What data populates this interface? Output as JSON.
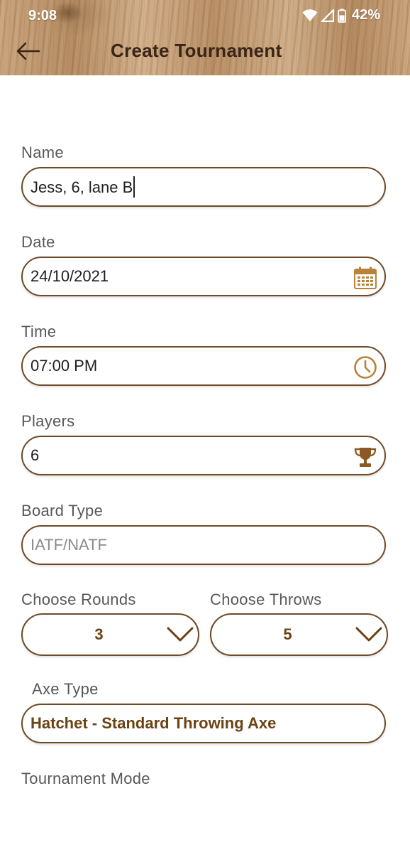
{
  "status_bar": {
    "time": "9:08",
    "battery_percent": "42%",
    "icons": [
      "wifi-icon",
      "signal-icon",
      "battery-icon"
    ]
  },
  "header": {
    "title": "Create Tournament",
    "back_icon": "back-arrow-icon"
  },
  "form": {
    "name": {
      "label": "Name",
      "value": "Jess, 6, lane B"
    },
    "date": {
      "label": "Date",
      "value": "24/10/2021",
      "icon": "calendar-icon"
    },
    "time": {
      "label": "Time",
      "value": "07:00 PM",
      "icon": "clock-icon"
    },
    "players": {
      "label": "Players",
      "value": "6",
      "icon": "trophy-icon"
    },
    "board_type": {
      "label": "Board Type",
      "placeholder": "IATF/NATF"
    },
    "rounds": {
      "label": "Choose Rounds",
      "value": "3"
    },
    "throws": {
      "label": "Choose Throws",
      "value": "5"
    },
    "axe_type": {
      "label": "Axe Type",
      "value": "Hatchet - Standard Throwing Axe"
    },
    "tournament_mode": {
      "label": "Tournament Mode"
    }
  },
  "colors": {
    "accent_brown": "#6e4a28",
    "value_brown": "#6b4214",
    "icon_gold": "#b8823a"
  }
}
